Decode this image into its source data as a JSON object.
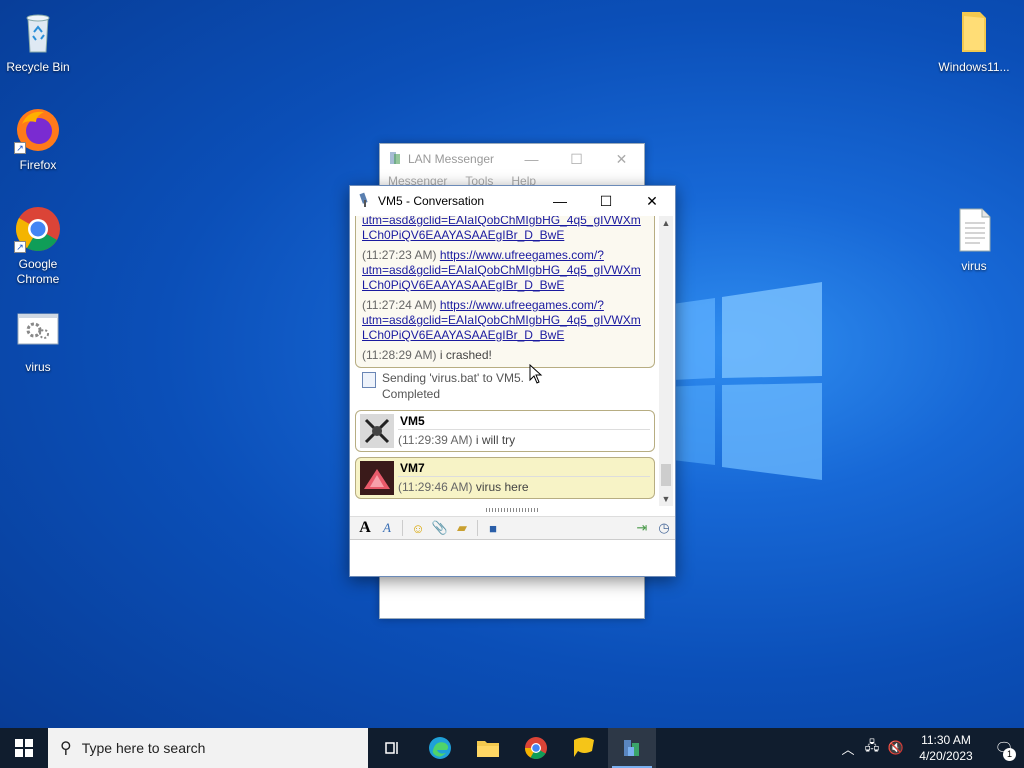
{
  "desktop": {
    "icons": [
      {
        "label": "Recycle Bin",
        "icon": "recycle-bin-icon"
      },
      {
        "label": "Firefox",
        "icon": "firefox-icon"
      },
      {
        "label": "Google Chrome",
        "icon": "chrome-icon"
      },
      {
        "label": "virus",
        "icon": "settings-file-icon"
      },
      {
        "label": "Windows11...",
        "icon": "folder-icon"
      },
      {
        "label": "virus",
        "icon": "text-file-icon"
      }
    ]
  },
  "lan_window": {
    "title": "LAN Messenger",
    "menu": [
      "Messenger",
      "Tools",
      "Help"
    ]
  },
  "conversation": {
    "title": "VM5 - Conversation",
    "messages": [
      {
        "time": "",
        "link_lines": [
          "utm=asd&gclid=EAIaIQobChMIgbHG_4q5_gIVWXm",
          "LCh0PiQV6EAAYASAAEgIBr_D_BwE"
        ]
      },
      {
        "time": "(11:27:23 AM)",
        "link_lines": [
          "https://www.ufreegames.com/?",
          "utm=asd&gclid=EAIaIQobChMIgbHG_4q5_gIVWXm",
          "LCh0PiQV6EAAYASAAEgIBr_D_BwE"
        ]
      },
      {
        "time": "(11:27:24 AM)",
        "link_lines": [
          "https://www.ufreegames.com/?",
          "utm=asd&gclid=EAIaIQobChMIgbHG_4q5_gIVWXm",
          "LCh0PiQV6EAAYASAAEgIBr_D_BwE"
        ]
      },
      {
        "time": "(11:28:29 AM)",
        "text": "i crashed!"
      }
    ],
    "file_transfer": {
      "line1": "Sending 'virus.bat' to VM5.",
      "line2": "Completed"
    },
    "cards": [
      {
        "name": "VM5",
        "time": "(11:29:39 AM)",
        "text": "i will try",
        "bg": "#ffffff"
      },
      {
        "name": "VM7",
        "time": "(11:29:46 AM)",
        "text": "virus here",
        "bg": "#f7f3c6"
      }
    ],
    "input_value": ""
  },
  "taskbar": {
    "search_placeholder": "Type here to search",
    "apps": [
      "task-view-icon",
      "edge-icon",
      "file-explorer-icon",
      "chrome-icon",
      "messenger-icon",
      "lan-messenger-icon"
    ],
    "clock_time": "11:30 AM",
    "clock_date": "4/20/2023",
    "notification_count": "1"
  },
  "colors": {
    "accent": "#0b4fb8",
    "link": "#1a1aa0",
    "bubble_border": "#b7ad82",
    "vm7_bg": "#f7f3c6"
  }
}
